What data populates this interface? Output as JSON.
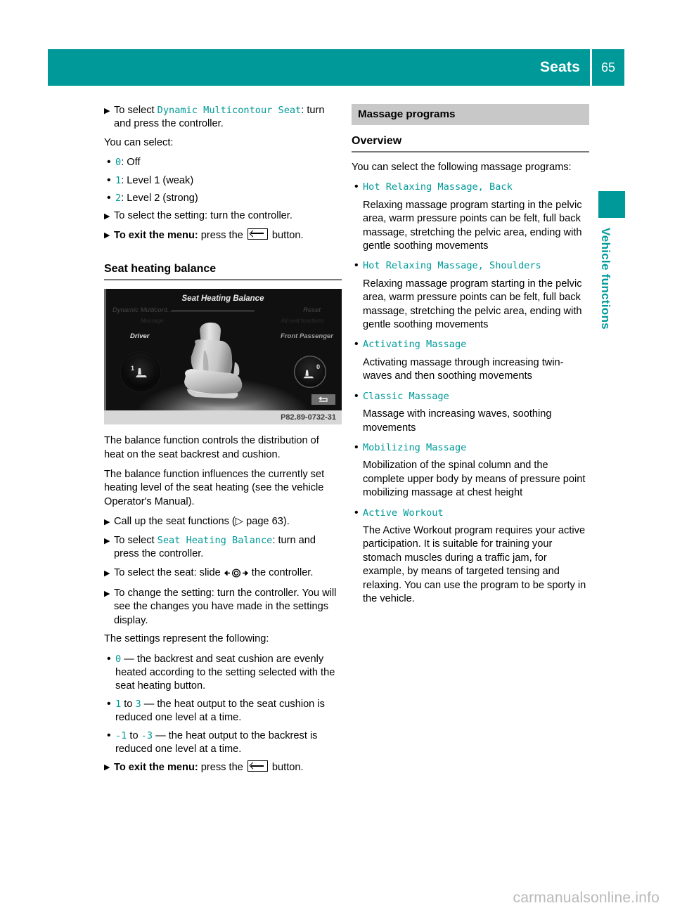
{
  "header": {
    "title": "Seats",
    "page_number": "65",
    "band_color": "#009999"
  },
  "side_tab": {
    "label": "Vehicle functions",
    "color": "#009999"
  },
  "accent_color": "#009999",
  "left_column": {
    "step_select_dms": {
      "prefix": "To select ",
      "menu": "Dynamic Multicontour Seat",
      "suffix": ": turn and press the controller."
    },
    "you_can_select": "You can select:",
    "levels": [
      {
        "value": "0",
        "text": ": Off"
      },
      {
        "value": "1",
        "text": ": Level 1 (weak)"
      },
      {
        "value": "2",
        "text": ": Level 2 (strong)"
      }
    ],
    "step_select_setting": "To select the setting: turn the controller.",
    "step_exit_1": {
      "bold": "To exit the menu:",
      "before": " press the ",
      "after": " button."
    },
    "heading_seat_heating_balance": "Seat heating balance",
    "figure": {
      "screen_title": "Seat Heating Balance",
      "label_top_left": "Dynamic Multicont...",
      "label_top_left_sub": "Massage",
      "label_top_right": "Reset",
      "label_top_right_sub": "All seat functions",
      "label_driver": "Driver",
      "label_passenger": "Front Passenger",
      "dial_left_value": "1",
      "dial_right_value": "0",
      "caption": "P82.89-0732-31"
    },
    "para_balance_1": "The balance function controls the distribution of heat on the seat backrest and cushion.",
    "para_balance_2": "The balance function influences the currently set heating level of the seat heating (see the vehicle Operator's Manual).",
    "step_call_up": {
      "before": "Call up the seat functions (",
      "ref": " page 63",
      "after": ")."
    },
    "step_select_shb": {
      "prefix": "To select ",
      "menu": "Seat Heating Balance",
      "suffix": ": turn and press the controller."
    },
    "step_select_seat": {
      "before": "To select the seat: slide ",
      "after": " the controller."
    },
    "step_change_setting": "To change the setting: turn the controller. You will see the changes you have made in the settings display.",
    "para_settings_represent": "The settings represent the following:",
    "settings": [
      {
        "value": "0",
        "dash": " — ",
        "text": "the backrest and seat cushion are evenly heated according to the setting selected with the seat heating button."
      },
      {
        "value": "1",
        "mid": " to ",
        "value2": "3",
        "dash": " — ",
        "text": "the heat output to the seat cushion is reduced one level at a time."
      },
      {
        "value": "-1",
        "mid": " to ",
        "value2": "-3",
        "dash": " — ",
        "text": "the heat output to the backrest is reduced one level at a time."
      }
    ],
    "step_exit_2": {
      "bold": "To exit the menu:",
      "before": " press the ",
      "after": " button."
    }
  },
  "right_column": {
    "section_heading": "Massage programs",
    "sub_heading": "Overview",
    "intro": "You can select the following massage programs:",
    "programs": [
      {
        "name": "Hot Relaxing Massage, Back",
        "description": "Relaxing massage program starting in the pelvic area, warm pressure points can be felt, full back massage, stretching the pelvic area, ending with gentle soothing movements"
      },
      {
        "name": "Hot Relaxing Massage, Shoulders",
        "description": "Relaxing massage program starting in the pelvic area, warm pressure points can be felt, full back massage, stretching the pelvic area, ending with gentle soothing movements"
      },
      {
        "name": "Activating Massage",
        "description": "Activating massage through increasing twin-waves and then soothing movements"
      },
      {
        "name": "Classic Massage",
        "description": "Massage with increasing waves, soothing movements"
      },
      {
        "name": "Mobilizing Massage",
        "description": "Mobilization of the spinal column and the complete upper body by means of pressure point mobilizing massage at chest height"
      },
      {
        "name": "Active Workout",
        "description": "The Active Workout program requires your active participation. It is suitable for training your stomach muscles during a traffic jam, for example, by means of targeted tensing and relaxing. You can use the program to be sporty in the vehicle."
      }
    ]
  },
  "watermark": "carmanualsonline.info"
}
